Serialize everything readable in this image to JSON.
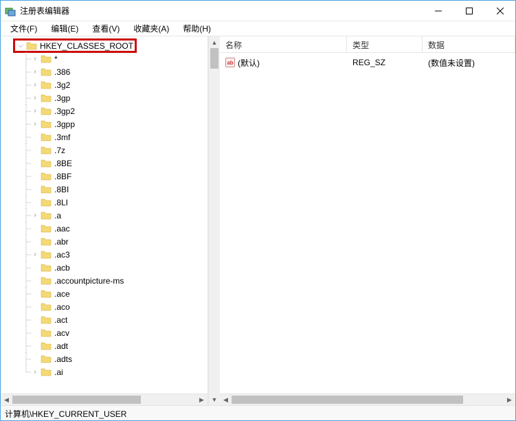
{
  "title": "注册表编辑器",
  "menu": {
    "file": "文件(F)",
    "edit": "编辑(E)",
    "view": "查看(V)",
    "favorites": "收藏夹(A)",
    "help": "帮助(H)"
  },
  "tree": {
    "root": "HKEY_CLASSES_ROOT",
    "items": [
      {
        "label": "*",
        "expandable": true
      },
      {
        "label": ".386",
        "expandable": true
      },
      {
        "label": ".3g2",
        "expandable": true
      },
      {
        "label": ".3gp",
        "expandable": true
      },
      {
        "label": ".3gp2",
        "expandable": true
      },
      {
        "label": ".3gpp",
        "expandable": true
      },
      {
        "label": ".3mf",
        "expandable": false
      },
      {
        "label": ".7z",
        "expandable": false
      },
      {
        "label": ".8BE",
        "expandable": false
      },
      {
        "label": ".8BF",
        "expandable": false
      },
      {
        "label": ".8BI",
        "expandable": false
      },
      {
        "label": ".8LI",
        "expandable": false
      },
      {
        "label": ".a",
        "expandable": true
      },
      {
        "label": ".aac",
        "expandable": false
      },
      {
        "label": ".abr",
        "expandable": false
      },
      {
        "label": ".ac3",
        "expandable": true
      },
      {
        "label": ".acb",
        "expandable": false
      },
      {
        "label": ".accountpicture-ms",
        "expandable": false
      },
      {
        "label": ".ace",
        "expandable": false
      },
      {
        "label": ".aco",
        "expandable": false
      },
      {
        "label": ".act",
        "expandable": false
      },
      {
        "label": ".acv",
        "expandable": false
      },
      {
        "label": ".adt",
        "expandable": false
      },
      {
        "label": ".adts",
        "expandable": false
      },
      {
        "label": ".ai",
        "expandable": true
      }
    ]
  },
  "list": {
    "headers": {
      "name": "名称",
      "type": "类型",
      "data": "数据"
    },
    "rows": [
      {
        "name": "(默认)",
        "type": "REG_SZ",
        "data": "(数值未设置)"
      }
    ]
  },
  "statusbar": "计算机\\HKEY_CURRENT_USER",
  "cols": {
    "name": 185,
    "type": 110,
    "data": 140
  }
}
